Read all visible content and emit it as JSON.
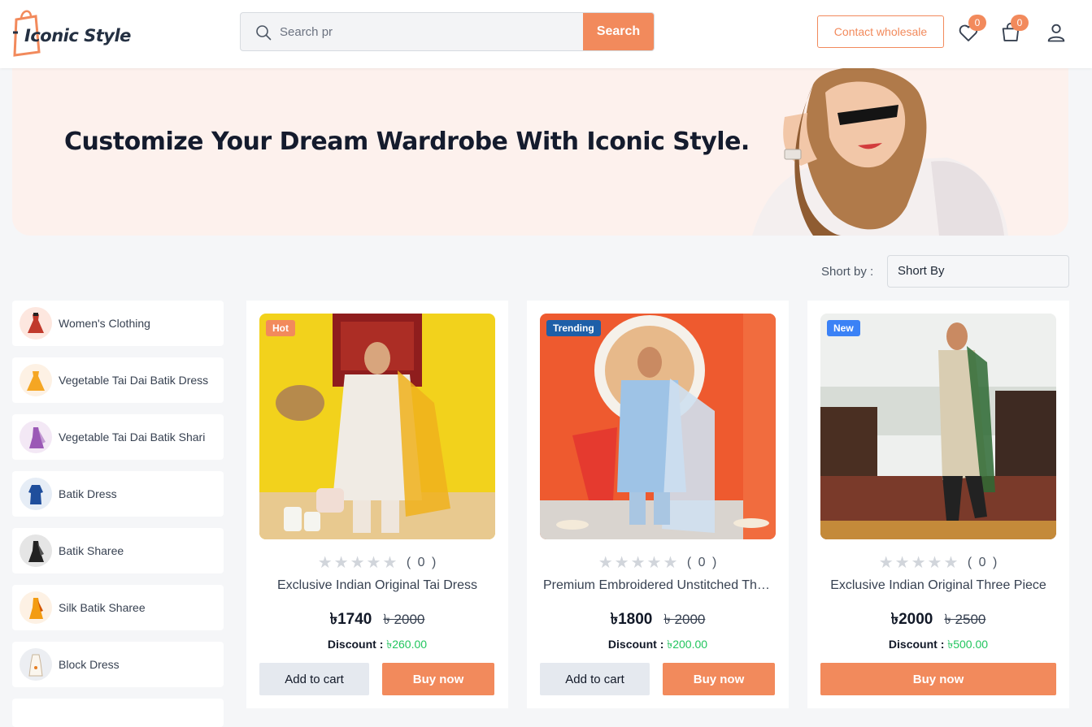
{
  "brand": {
    "name": "Iconic Style",
    "accent": "#f28a5c"
  },
  "header": {
    "search_placeholder": "Search pr",
    "search_button": "Search",
    "contact_button": "Contact wholesale",
    "wishlist_count": "0",
    "cart_count": "0"
  },
  "banner": {
    "title": "Customize Your Dream Wardrobe With Iconic Style."
  },
  "sort": {
    "label": "Short by :",
    "selected": "Short By"
  },
  "categories": [
    {
      "label": "Women's Clothing",
      "icon": "dress-icon"
    },
    {
      "label": "Vegetable Tai Dai Batik Dress",
      "icon": "yellow-dress-icon"
    },
    {
      "label": "Vegetable Tai Dai Batik Shari",
      "icon": "purple-shari-icon"
    },
    {
      "label": "Batik Dress",
      "icon": "blue-dress-icon"
    },
    {
      "label": "Batik Sharee",
      "icon": "black-sharee-icon"
    },
    {
      "label": "Silk Batik Sharee",
      "icon": "orange-sharee-icon"
    },
    {
      "label": "Block Dress",
      "icon": "white-dress-icon"
    }
  ],
  "products": [
    {
      "tag": "Hot",
      "tag_color": "#f28a5c",
      "rating_count": "( 0 )",
      "title": "Exclusive Indian Original Tai Dress",
      "price": "৳1740",
      "old_price": "৳ 2000",
      "discount_label": "Discount : ",
      "discount": "৳260.00",
      "add_to_cart": "Add to cart",
      "buy_now": "Buy now"
    },
    {
      "tag": "Trending",
      "tag_color": "#1e5fa8",
      "rating_count": "( 0 )",
      "title": "Premium Embroidered Unstitched Three Piece",
      "price": "৳1800",
      "old_price": "৳ 2000",
      "discount_label": "Discount : ",
      "discount": "৳200.00",
      "add_to_cart": "Add to cart",
      "buy_now": "Buy now"
    },
    {
      "tag": "New",
      "tag_color": "#3b82f6",
      "rating_count": "( 0 )",
      "title": "Exclusive Indian Original Three Piece",
      "price": "৳2000",
      "old_price": "৳ 2500",
      "discount_label": "Discount : ",
      "discount": "৳500.00",
      "buy_now": "Buy now"
    }
  ]
}
